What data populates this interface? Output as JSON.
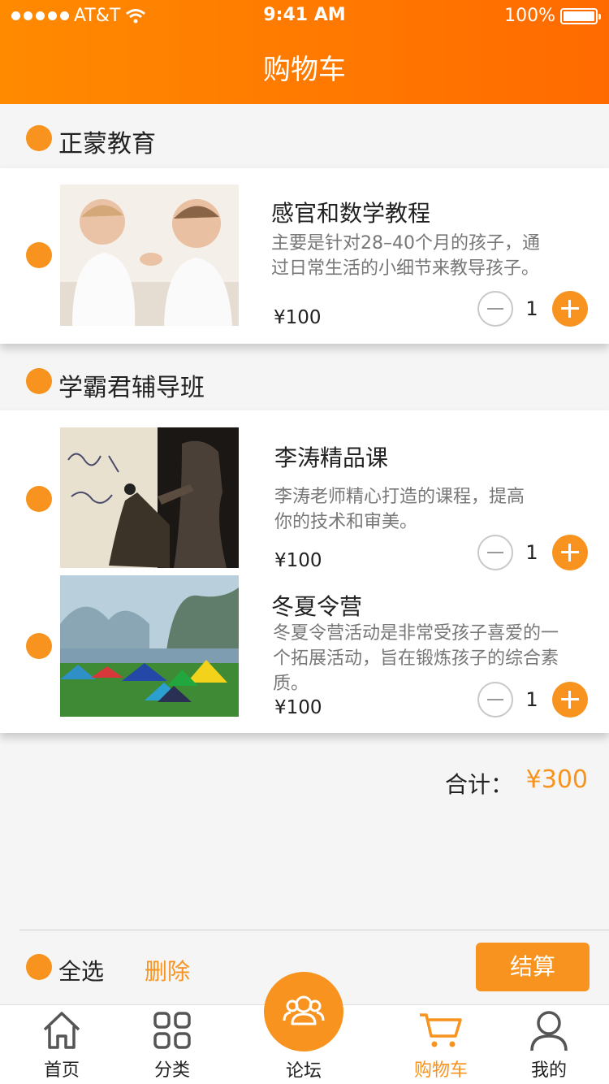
{
  "status_bar": {
    "carrier": "AT&T",
    "time": "9:41 AM",
    "battery": "100%"
  },
  "header": {
    "title": "购物车"
  },
  "shops": [
    {
      "name": "正蒙教育",
      "items": [
        {
          "title": "感官和数学教程",
          "desc": "主要是针对28–40个月的孩子，通过日常生活的小细节来教导孩子。",
          "price": "¥100",
          "qty": "1"
        }
      ]
    },
    {
      "name": "学霸君辅导班",
      "items": [
        {
          "title": "李涛精品课",
          "desc": "李涛老师精心打造的课程，提高你的技术和审美。",
          "price": "¥100",
          "qty": "1"
        },
        {
          "title": "冬夏令营",
          "desc": "冬夏令营活动是非常受孩子喜爱的一个拓展活动，旨在锻炼孩子的综合素质。",
          "price": "¥100",
          "qty": "1"
        }
      ]
    }
  ],
  "summary": {
    "total_label": "合计：",
    "total_value": "¥300"
  },
  "actions": {
    "select_all": "全选",
    "delete": "删除",
    "checkout": "结算"
  },
  "tabs": [
    {
      "label": "首页",
      "icon": "home-icon"
    },
    {
      "label": "分类",
      "icon": "grid-icon"
    },
    {
      "label": "论坛",
      "icon": "users-icon"
    },
    {
      "label": "购物车",
      "icon": "cart-icon",
      "active": true
    },
    {
      "label": "我的",
      "icon": "person-icon"
    }
  ],
  "colors": {
    "accent": "#f7931e",
    "header_start": "#ff8a00",
    "header_end": "#ff6a00"
  }
}
